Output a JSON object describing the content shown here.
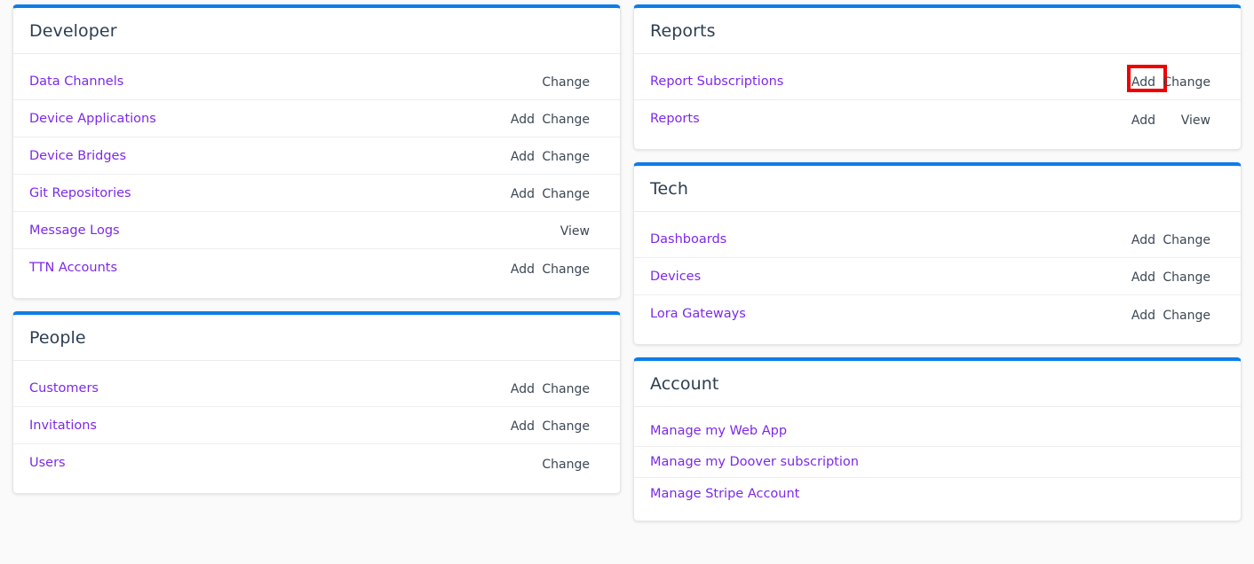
{
  "theme": {
    "accent_blue": "#0d7de8",
    "link_purple": "#7d29e8",
    "action_text": "#3b4754",
    "highlight_red": "#ee0000",
    "page_background": "#fafafa",
    "card_background": "#ffffff"
  },
  "labels": {
    "add": "Add",
    "change": "Change",
    "view": "View"
  },
  "cards": {
    "developer": {
      "title": "Developer",
      "rows": [
        {
          "name": "Data Channels",
          "add": "",
          "secondary": "Change"
        },
        {
          "name": "Device Applications",
          "add": "Add",
          "secondary": "Change"
        },
        {
          "name": "Device Bridges",
          "add": "Add",
          "secondary": "Change"
        },
        {
          "name": "Git Repositories",
          "add": "Add",
          "secondary": "Change"
        },
        {
          "name": "Message Logs",
          "add": "",
          "secondary": "View"
        },
        {
          "name": "TTN Accounts",
          "add": "Add",
          "secondary": "Change"
        }
      ]
    },
    "people": {
      "title": "People",
      "rows": [
        {
          "name": "Customers",
          "add": "Add",
          "secondary": "Change"
        },
        {
          "name": "Invitations",
          "add": "Add",
          "secondary": "Change"
        },
        {
          "name": "Users",
          "add": "",
          "secondary": "Change"
        }
      ]
    },
    "reports": {
      "title": "Reports",
      "rows": [
        {
          "name": "Report Subscriptions",
          "add": "Add",
          "secondary": "Change",
          "highlight": "add"
        },
        {
          "name": "Reports",
          "add": "Add",
          "secondary": "View"
        }
      ]
    },
    "tech": {
      "title": "Tech",
      "rows": [
        {
          "name": "Dashboards",
          "add": "Add",
          "secondary": "Change"
        },
        {
          "name": "Devices",
          "add": "Add",
          "secondary": "Change"
        },
        {
          "name": "Lora Gateways",
          "add": "Add",
          "secondary": "Change"
        }
      ]
    },
    "account": {
      "title": "Account",
      "rows": [
        {
          "name": "Manage my Web App"
        },
        {
          "name": "Manage my Doover subscription"
        },
        {
          "name": "Manage Stripe Account"
        }
      ]
    }
  }
}
